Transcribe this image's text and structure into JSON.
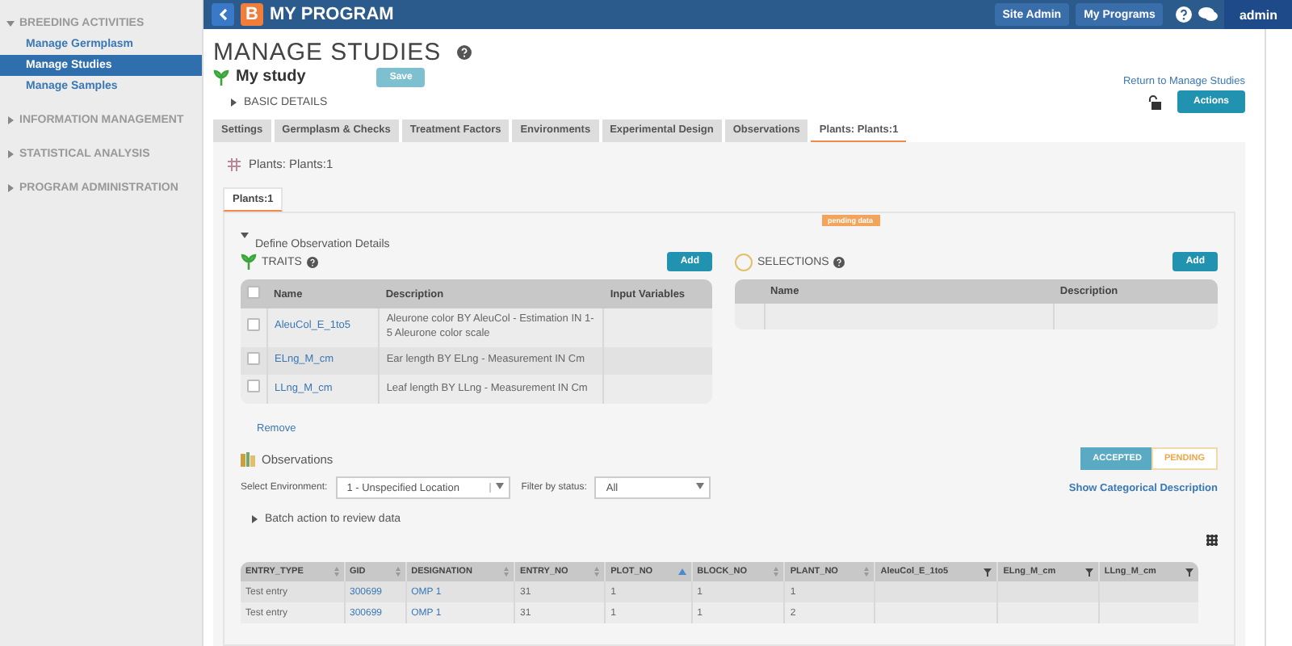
{
  "sidebar": {
    "sections": [
      {
        "label": "BREEDING ACTIVITIES",
        "expanded": true,
        "items": [
          {
            "label": "Manage Germplasm",
            "selected": false
          },
          {
            "label": "Manage Studies",
            "selected": true
          },
          {
            "label": "Manage Samples",
            "selected": false
          }
        ]
      },
      {
        "label": "INFORMATION MANAGEMENT",
        "expanded": false
      },
      {
        "label": "STATISTICAL ANALYSIS",
        "expanded": false
      },
      {
        "label": "PROGRAM ADMINISTRATION",
        "expanded": false
      }
    ]
  },
  "topbar": {
    "logo": "B",
    "title": "MY PROGRAM",
    "buttons": [
      "Site Admin",
      "My Programs"
    ],
    "user": "admin"
  },
  "header": {
    "title": "MANAGE STUDIES",
    "study": "My study",
    "save": "Save",
    "basic_details": "BASIC DETAILS",
    "return_link": "Return to Manage Studies",
    "actions": "Actions",
    "locked": false
  },
  "tabs": [
    {
      "label": "Settings",
      "selected": false
    },
    {
      "label": "Germplasm & Checks",
      "selected": false
    },
    {
      "label": "Treatment Factors",
      "selected": false
    },
    {
      "label": "Environments",
      "selected": false
    },
    {
      "label": "Experimental Design",
      "selected": false
    },
    {
      "label": "Observations",
      "selected": false
    },
    {
      "label": "Plants: Plants:1",
      "selected": true
    }
  ],
  "section_title": "Plants: Plants:1",
  "subtabs": [
    {
      "label": "Plants:1",
      "selected": true
    }
  ],
  "define": {
    "label": "Define Observation Details",
    "expanded": true,
    "badge": "pending data"
  },
  "traits": {
    "title": "TRAITS",
    "add": "Add",
    "all_checked": false,
    "columns": [
      "Name",
      "Description",
      "Input Variables"
    ],
    "rows": [
      {
        "name": "AleuCol_E_1to5",
        "description": "Aleurone color BY AleuCol - Estimation IN 1-5 Aleurone color scale",
        "checked": false
      },
      {
        "name": "ELng_M_cm",
        "description": "Ear length BY ELng - Measurement IN Cm",
        "checked": false
      },
      {
        "name": "LLng_M_cm",
        "description": "Leaf length BY LLng - Measurement IN Cm",
        "checked": false
      }
    ],
    "remove": "Remove"
  },
  "selections": {
    "title": "SELECTIONS",
    "add": "Add",
    "columns": [
      "Name",
      "Description"
    ]
  },
  "observations": {
    "title": "Observations",
    "env_label": "Select Environment:",
    "env_value": "1 - Unspecified Location",
    "filter_label": "Filter by status:",
    "filter_value": "All",
    "toggle": [
      {
        "label": "ACCEPTED",
        "selected": true
      },
      {
        "label": "PENDING",
        "selected": false
      }
    ],
    "show_link": "Show Categorical Description",
    "batch": "Batch action to review data",
    "columns": [
      {
        "label": "ENTRY_TYPE",
        "kind": "sortable"
      },
      {
        "label": "GID",
        "kind": "sortable"
      },
      {
        "label": "DESIGNATION",
        "kind": "sortable"
      },
      {
        "label": "ENTRY_NO",
        "kind": "sortable"
      },
      {
        "label": "PLOT_NO",
        "kind": "sorted"
      },
      {
        "label": "BLOCK_NO",
        "kind": "sortable"
      },
      {
        "label": "PLANT_NO",
        "kind": "sortable"
      },
      {
        "label": "AleuCol_E_1to5",
        "kind": "filter"
      },
      {
        "label": "ELng_M_cm",
        "kind": "filter"
      },
      {
        "label": "LLng_M_cm",
        "kind": "filter"
      }
    ],
    "rows": [
      [
        {
          "text": "Test entry",
          "link": false
        },
        {
          "text": "300699",
          "link": true
        },
        {
          "text": "OMP 1",
          "link": true
        },
        {
          "text": "31",
          "link": false
        },
        {
          "text": "1",
          "link": false
        },
        {
          "text": "1",
          "link": false
        },
        {
          "text": "1",
          "link": false
        }
      ],
      [
        {
          "text": "Test entry",
          "link": false
        },
        {
          "text": "300699",
          "link": true
        },
        {
          "text": "OMP 1",
          "link": true
        },
        {
          "text": "31",
          "link": false
        },
        {
          "text": "1",
          "link": false
        },
        {
          "text": "1",
          "link": false
        },
        {
          "text": "2",
          "link": false
        }
      ]
    ]
  }
}
